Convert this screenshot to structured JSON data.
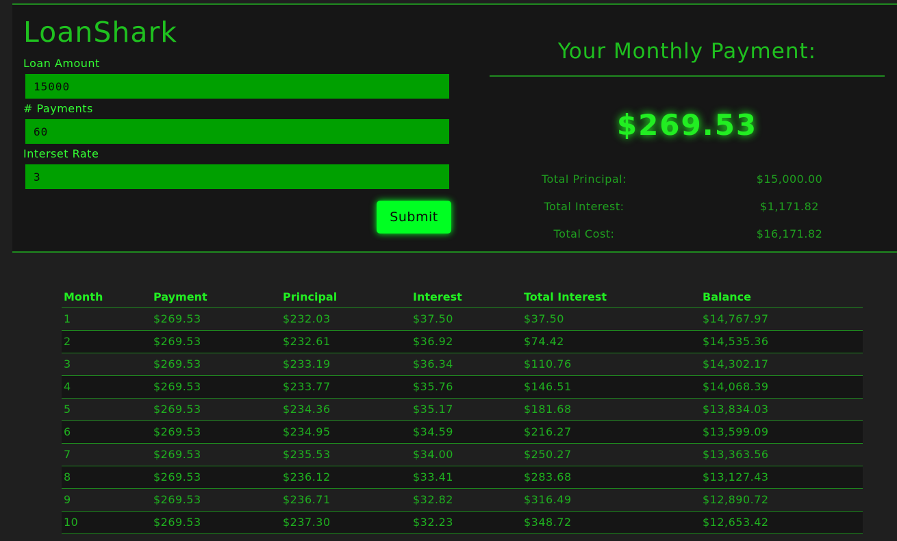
{
  "app": {
    "title": "LoanShark"
  },
  "form": {
    "loan_amount_label": "Loan Amount",
    "loan_amount_value": "15000",
    "payments_label": "# Payments",
    "payments_value": "60",
    "rate_label": "Interset Rate",
    "rate_value": "3",
    "submit_label": "Submit"
  },
  "result": {
    "heading": "Your Monthly Payment:",
    "monthly_payment": "$269.53",
    "total_principal_label": "Total Principal:",
    "total_principal_value": "$15,000.00",
    "total_interest_label": "Total Interest:",
    "total_interest_value": "$1,171.82",
    "total_cost_label": "Total Cost:",
    "total_cost_value": "$16,171.82"
  },
  "schedule": {
    "headers": [
      "Month",
      "Payment",
      "Principal",
      "Interest",
      "Total Interest",
      "Balance"
    ],
    "rows": [
      [
        "1",
        "$269.53",
        "$232.03",
        "$37.50",
        "$37.50",
        "$14,767.97"
      ],
      [
        "2",
        "$269.53",
        "$232.61",
        "$36.92",
        "$74.42",
        "$14,535.36"
      ],
      [
        "3",
        "$269.53",
        "$233.19",
        "$36.34",
        "$110.76",
        "$14,302.17"
      ],
      [
        "4",
        "$269.53",
        "$233.77",
        "$35.76",
        "$146.51",
        "$14,068.39"
      ],
      [
        "5",
        "$269.53",
        "$234.36",
        "$35.17",
        "$181.68",
        "$13,834.03"
      ],
      [
        "6",
        "$269.53",
        "$234.95",
        "$34.59",
        "$216.27",
        "$13,599.09"
      ],
      [
        "7",
        "$269.53",
        "$235.53",
        "$34.00",
        "$250.27",
        "$13,363.56"
      ],
      [
        "8",
        "$269.53",
        "$236.12",
        "$33.41",
        "$283.68",
        "$13,127.43"
      ],
      [
        "9",
        "$269.53",
        "$236.71",
        "$32.82",
        "$316.49",
        "$12,890.72"
      ],
      [
        "10",
        "$269.53",
        "$237.30",
        "$32.23",
        "$348.72",
        "$12,653.42"
      ]
    ]
  }
}
